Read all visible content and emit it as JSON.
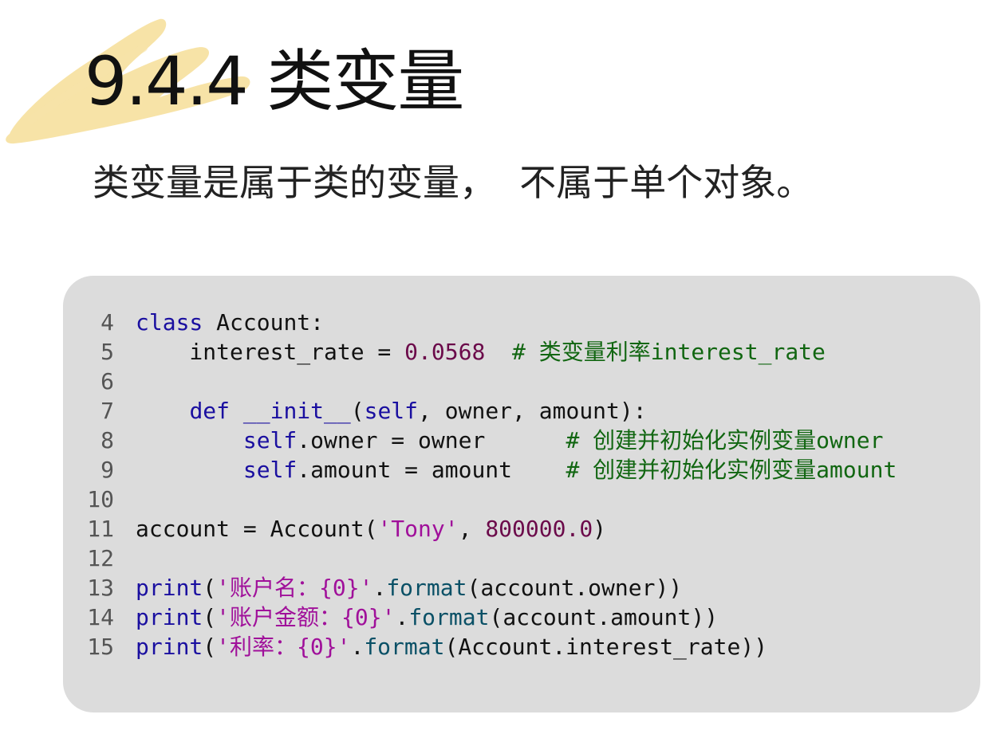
{
  "slide": {
    "title": "9.4.4 类变量",
    "subtitle": "类变量是属于类的变量，  不属于单个对象。"
  },
  "code": {
    "lines": [
      {
        "num": "4",
        "tokens": [
          {
            "t": "class",
            "c": "kw"
          },
          {
            "t": " Account:",
            "c": ""
          }
        ]
      },
      {
        "num": "5",
        "tokens": [
          {
            "t": "    interest_rate = ",
            "c": ""
          },
          {
            "t": "0.0568",
            "c": "num"
          },
          {
            "t": "  # 类变量利率interest_rate",
            "c": "cmt"
          }
        ]
      },
      {
        "num": "6",
        "tokens": []
      },
      {
        "num": "7",
        "tokens": [
          {
            "t": "    ",
            "c": ""
          },
          {
            "t": "def",
            "c": "kw"
          },
          {
            "t": " ",
            "c": ""
          },
          {
            "t": "__init__",
            "c": "kw"
          },
          {
            "t": "(",
            "c": ""
          },
          {
            "t": "self",
            "c": "kw"
          },
          {
            "t": ", owner, amount):",
            "c": ""
          }
        ]
      },
      {
        "num": "8",
        "tokens": [
          {
            "t": "        ",
            "c": ""
          },
          {
            "t": "self",
            "c": "kw"
          },
          {
            "t": ".owner = owner      ",
            "c": ""
          },
          {
            "t": "# 创建并初始化实例变量owner",
            "c": "cmt"
          }
        ]
      },
      {
        "num": "9",
        "tokens": [
          {
            "t": "        ",
            "c": ""
          },
          {
            "t": "self",
            "c": "kw"
          },
          {
            "t": ".amount = amount    ",
            "c": ""
          },
          {
            "t": "# 创建并初始化实例变量amount",
            "c": "cmt"
          }
        ]
      },
      {
        "num": "10",
        "tokens": []
      },
      {
        "num": "11",
        "tokens": [
          {
            "t": "account = Account(",
            "c": ""
          },
          {
            "t": "'Tony'",
            "c": "str"
          },
          {
            "t": ", ",
            "c": ""
          },
          {
            "t": "800000.0",
            "c": "num"
          },
          {
            "t": ")",
            "c": ""
          }
        ]
      },
      {
        "num": "12",
        "tokens": []
      },
      {
        "num": "13",
        "tokens": [
          {
            "t": "print",
            "c": "kw"
          },
          {
            "t": "(",
            "c": ""
          },
          {
            "t": "'账户名：{0}'",
            "c": "str"
          },
          {
            "t": ".",
            "c": ""
          },
          {
            "t": "format",
            "c": "fn"
          },
          {
            "t": "(account.owner))",
            "c": ""
          }
        ]
      },
      {
        "num": "14",
        "tokens": [
          {
            "t": "print",
            "c": "kw"
          },
          {
            "t": "(",
            "c": ""
          },
          {
            "t": "'账户金额：{0}'",
            "c": "str"
          },
          {
            "t": ".",
            "c": ""
          },
          {
            "t": "format",
            "c": "fn"
          },
          {
            "t": "(account.amount))",
            "c": ""
          }
        ]
      },
      {
        "num": "15",
        "tokens": [
          {
            "t": "print",
            "c": "kw"
          },
          {
            "t": "(",
            "c": ""
          },
          {
            "t": "'利率：{0}'",
            "c": "str"
          },
          {
            "t": ".",
            "c": ""
          },
          {
            "t": "format",
            "c": "fn"
          },
          {
            "t": "(Account.interest_rate))",
            "c": ""
          }
        ]
      }
    ]
  },
  "colors": {
    "keyword": "#1a0fa0",
    "number": "#6b0a4a",
    "string": "#a0109a",
    "comment": "#116611",
    "code_background": "#dcdcdc",
    "brush_accent": "#f4d98a"
  }
}
